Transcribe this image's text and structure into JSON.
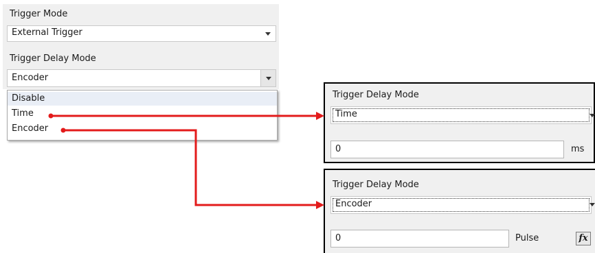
{
  "left_panel": {
    "trigger_mode_label": "Trigger Mode",
    "trigger_mode_value": "External Trigger",
    "trigger_delay_mode_label": "Trigger Delay Mode",
    "trigger_delay_mode_value": "Encoder",
    "dropdown_options": [
      "Disable",
      "Time",
      "Encoder"
    ]
  },
  "time_panel": {
    "title": "Trigger Delay Mode",
    "mode_value": "Time",
    "delay_value": "0",
    "unit": "ms"
  },
  "encoder_panel": {
    "title": "Trigger Delay Mode",
    "mode_value": "Encoder",
    "delay_value": "0",
    "unit": "Pulse",
    "fx_button_label": "fx"
  },
  "colors": {
    "connector": "#e31b1b",
    "panel_background": "#f0f0f0"
  },
  "icons": [
    "dropdown-arrow-icon",
    "function-icon"
  ]
}
